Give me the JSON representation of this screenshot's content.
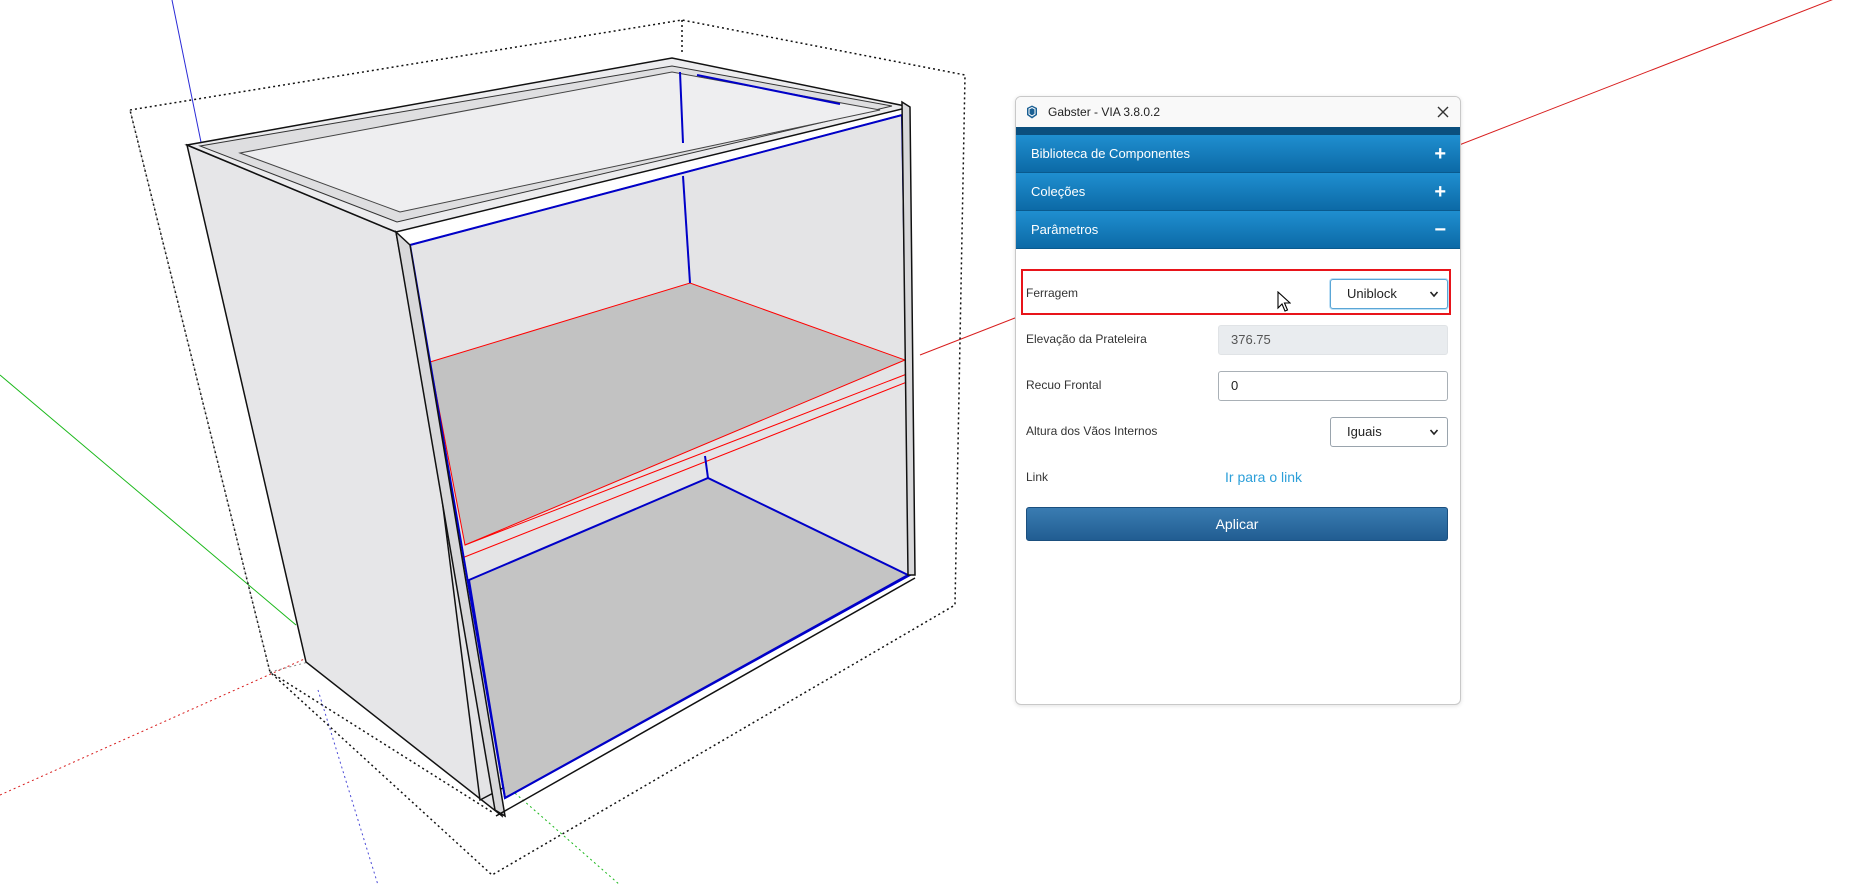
{
  "window": {
    "title": "Gabster - VIA 3.8.0.2",
    "icon": "sketchup-icon",
    "close_icon": "close-icon"
  },
  "accordion": [
    {
      "label": "Biblioteca de Componentes",
      "sign": "+",
      "state": "collapsed"
    },
    {
      "label": "Coleções",
      "sign": "+",
      "state": "collapsed"
    },
    {
      "label": "Parâmetros",
      "sign": "−",
      "state": "expanded"
    }
  ],
  "parameters": {
    "ferragem": {
      "label": "Ferragem",
      "value": "Uniblock"
    },
    "elevacao": {
      "label": "Elevação da Prateleira",
      "value": "376.75"
    },
    "recuo": {
      "label": "Recuo Frontal",
      "value": "0"
    },
    "altura": {
      "label": "Altura dos Vãos Internos",
      "value": "Iguais"
    },
    "link": {
      "label": "Link",
      "text": "Ir para o link"
    }
  },
  "apply_label": "Aplicar",
  "colors": {
    "accordion_blue": "#1a86c7",
    "highlight_red": "#e8141a",
    "link_blue": "#2c9fd9",
    "apply_blue": "#2d6ea5",
    "cabinet_edge_blue": "#0000c8",
    "shelf_selected_red": "#ff0000"
  }
}
